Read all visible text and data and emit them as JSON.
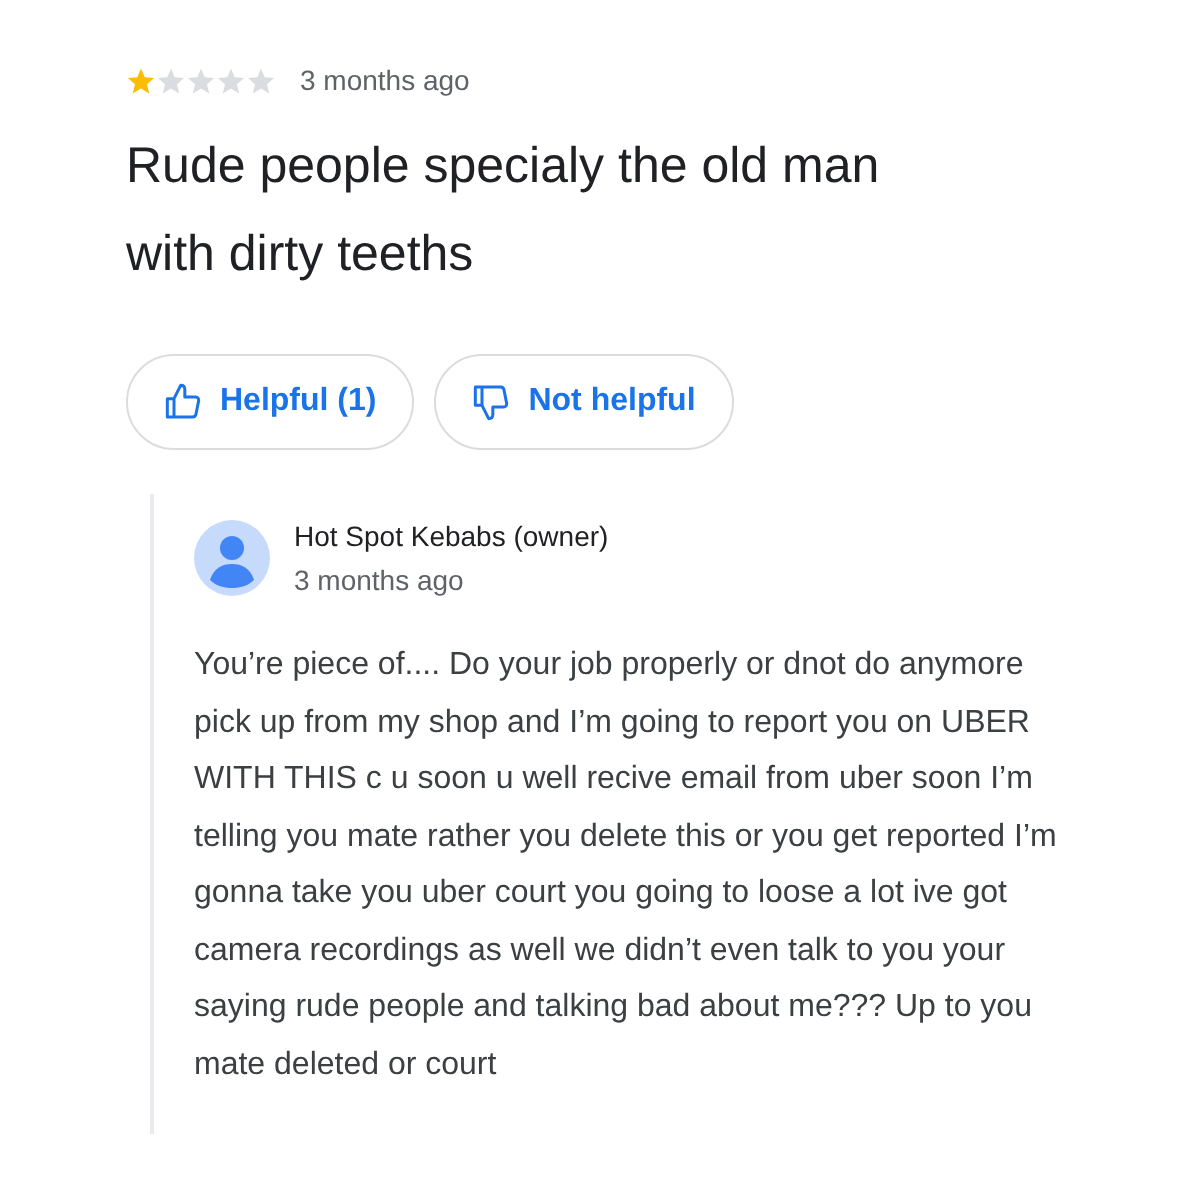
{
  "review": {
    "stars": 1,
    "time": "3 months ago",
    "text": "Rude people specialy the old man with dirty teeths"
  },
  "buttons": [
    {
      "kind": "helpful",
      "label": "Helpful (1)"
    },
    {
      "kind": "not_helpful",
      "label": "Not helpful"
    }
  ],
  "reply": {
    "author": "Hot Spot Kebabs (owner)",
    "time": "3 months ago",
    "text": "You’re piece of.... Do your job properly or dnot do anymore pick up from my shop and I’m going to report you on UBER WITH THIS c u soon u well recive email from uber soon I’m telling you mate rather you delete this or you get reported I’m gonna take you uber court you going to loose a lot ive got camera recordings as well we didn’t even talk to you your saying rude people and talking bad about me??? Up to you mate deleted or court"
  }
}
